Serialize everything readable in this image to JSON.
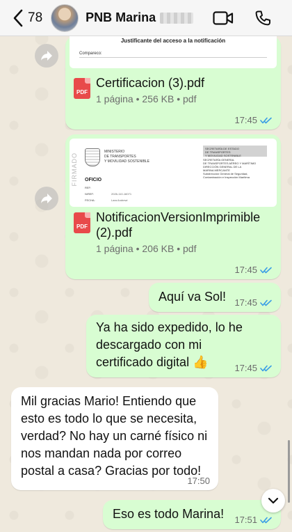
{
  "header": {
    "back_count": "78",
    "contact_name": "PNB Marina"
  },
  "messages": [
    {
      "type": "document",
      "direction": "outgoing",
      "preview_title": "Justificante del acceso a la notificación",
      "preview_sub": "Compareco:",
      "file_name": "Certificacion (3).pdf",
      "meta": "1 página • 256 KB • pdf",
      "time": "17:45"
    },
    {
      "type": "document",
      "direction": "outgoing",
      "preview": {
        "stamp": "FIRMADO",
        "ministry": "MINISTERIO\nDE TRANSPORTES\nY MOVILIDAD SOSTENIBLE",
        "box": "SECRETARÍA DE ESTADO\nDE TRANSPORTES\nY MOVILIDAD SOSTENIBLE",
        "right": "SECRETARÍA GENERAL\nDE TRANSPORTES AÉREO Y MARÍTIMO\nDIRECCIÓN GENERAL DE LA\nMARINA MERCANTE\nSubdirección General de Seguridad,\nContaminación e Inspección Marítima",
        "oficio": "OFICIO",
        "ref_labels": "REF:\nN/REF:\nFECHA:",
        "ref_values": "\n2026-110-16071\nLara Andrewi"
      },
      "file_name": "NotificacionVersionImprimible (2).pdf",
      "meta": "1 página • 206 KB • pdf",
      "time": "17:45"
    },
    {
      "type": "text",
      "direction": "outgoing",
      "text": "Aquí va Sol!",
      "time": "17:45"
    },
    {
      "type": "text",
      "direction": "outgoing",
      "text": "Ya ha sido expedido, lo he descargado con mi certificado digital 👍",
      "time": "17:45"
    },
    {
      "type": "text",
      "direction": "incoming",
      "text": "Mil gracias Mario! Entiendo que esto es todo lo que se necesita, verdad? No hay un carné físico ni nos mandan nada por correo postal a casa? Gracias por todo!",
      "time": "17:50"
    },
    {
      "type": "text",
      "direction": "outgoing",
      "text": "Eso es todo Marina!",
      "time": "17:51"
    }
  ],
  "colors": {
    "outgoing_bubble": "#d8fdd2",
    "incoming_bubble": "#ffffff",
    "read_ticks": "#3b9ee6",
    "pdf_icon": "#e84a4a"
  },
  "icons": [
    "back-chevron-icon",
    "video-call-icon",
    "phone-icon",
    "forward-icon",
    "pdf-icon",
    "read-ticks-icon",
    "scroll-down-icon"
  ]
}
